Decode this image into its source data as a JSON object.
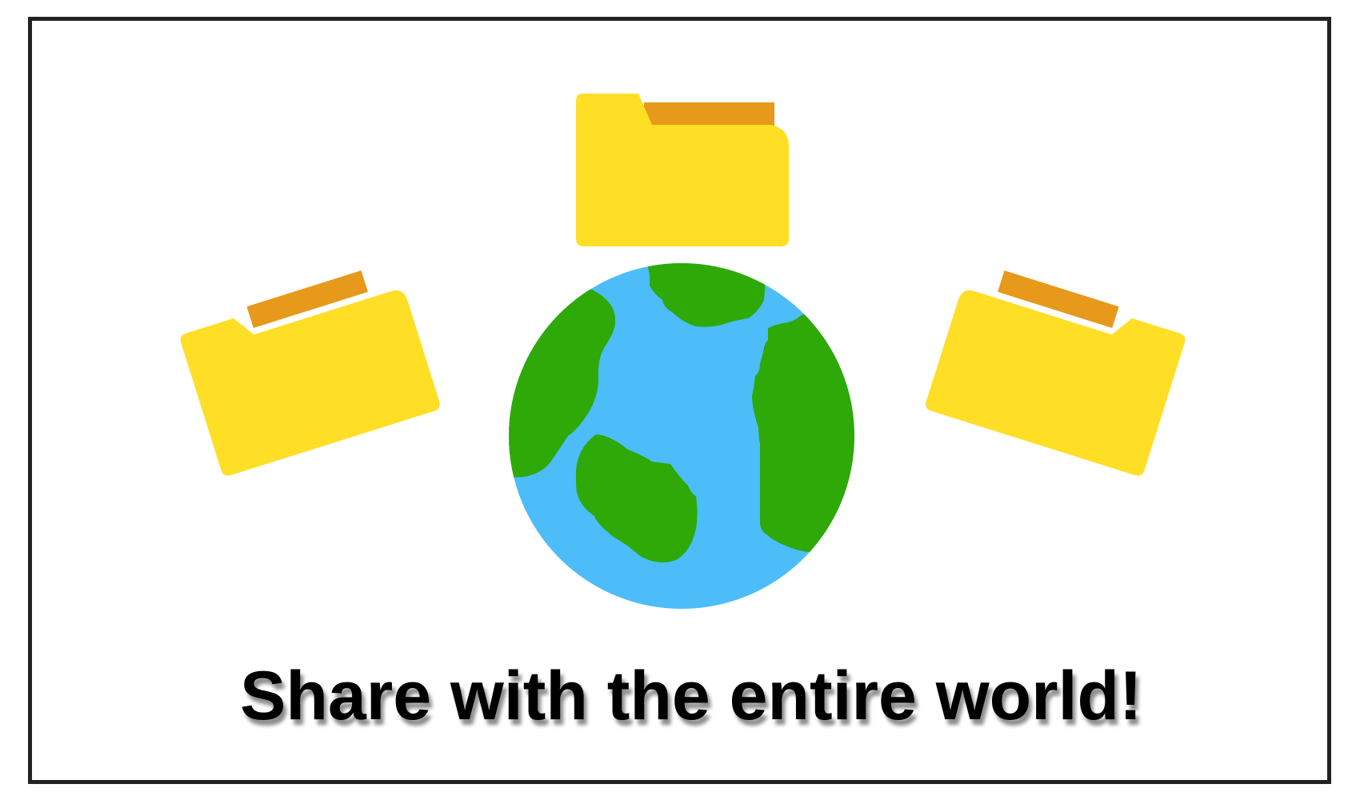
{
  "headline": "Share with the entire world!",
  "illustration": {
    "icons": [
      "folder-icon",
      "folder-icon",
      "folder-icon",
      "globe-icon"
    ],
    "colors": {
      "folder_body": "#FFDE26",
      "folder_tab": "#E6991A",
      "ocean": "#4CBDF8",
      "land": "#2EA907",
      "frame_border": "#222222",
      "text": "#000000"
    }
  }
}
